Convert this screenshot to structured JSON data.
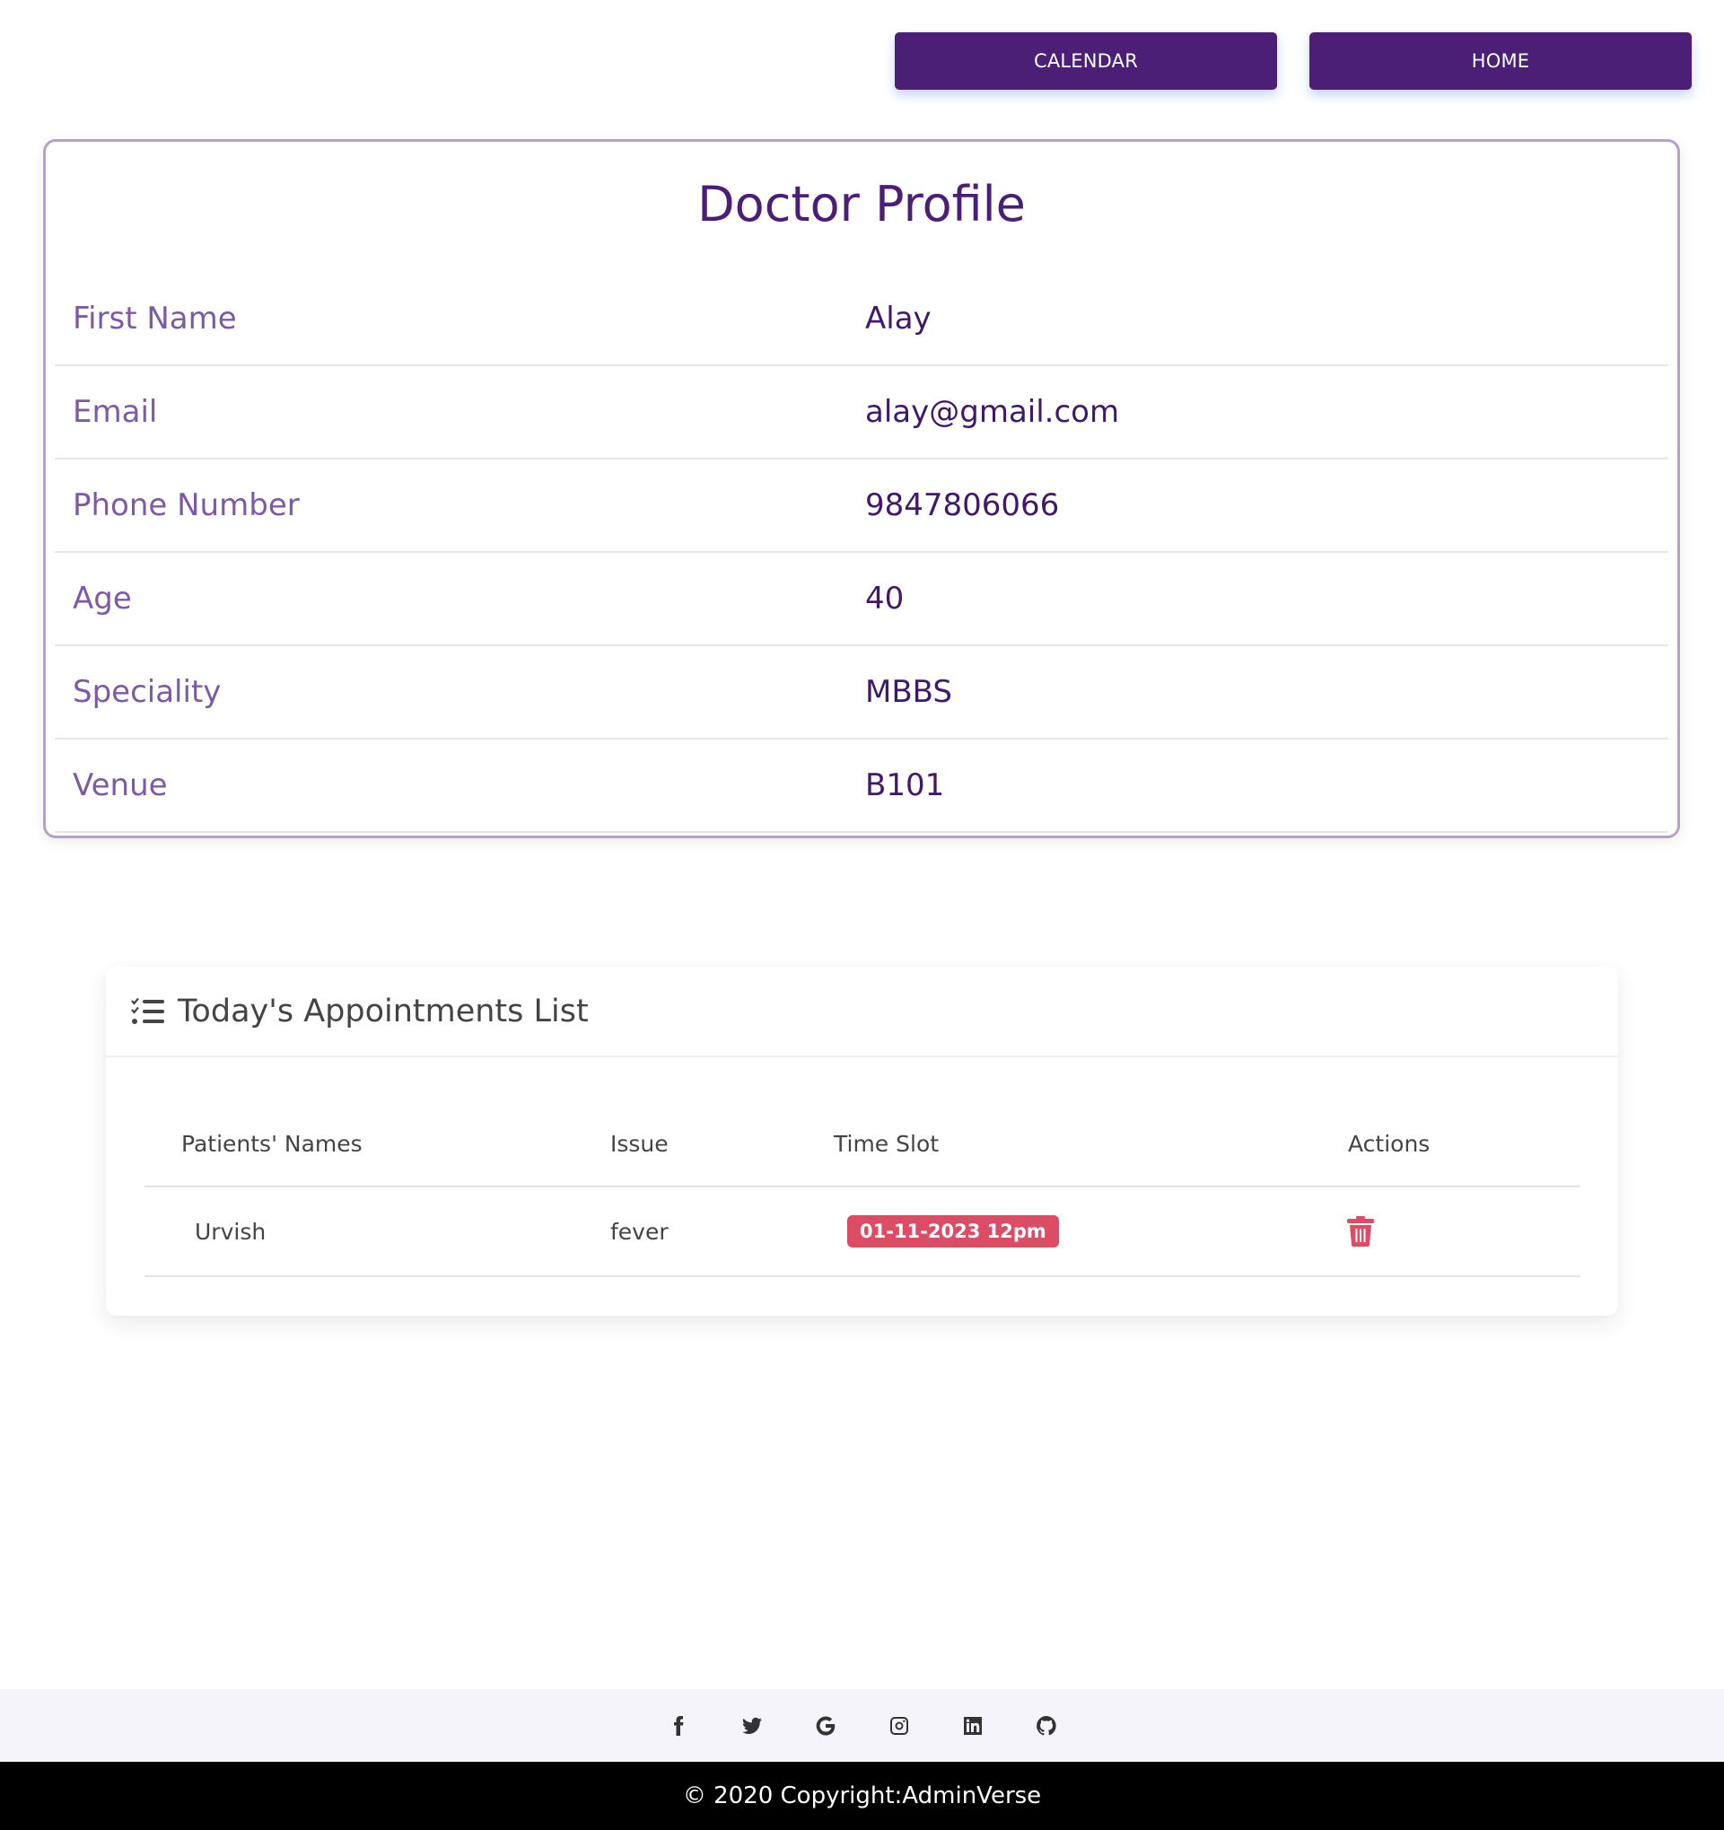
{
  "nav": {
    "calendar_label": "CALENDAR",
    "home_label": "HOME"
  },
  "profile": {
    "title": "Doctor Profile",
    "fields": [
      {
        "label": "First Name",
        "value": "Alay"
      },
      {
        "label": "Email",
        "value": "alay@gmail.com"
      },
      {
        "label": "Phone Number",
        "value": "9847806066"
      },
      {
        "label": "Age",
        "value": "40"
      },
      {
        "label": "Speciality",
        "value": "MBBS"
      },
      {
        "label": "Venue",
        "value": "B101"
      }
    ]
  },
  "appointments": {
    "title": "Today's Appointments List",
    "icon": "list-check-icon",
    "columns": [
      "Patients' Names",
      "Issue",
      "Time Slot",
      "Actions"
    ],
    "rows": [
      {
        "patient": "Urvish",
        "issue": "fever",
        "time_slot": "01-11-2023 12pm",
        "action_icon": "trash-icon"
      }
    ]
  },
  "footer": {
    "social_icons": [
      "facebook-icon",
      "twitter-icon",
      "google-icon",
      "instagram-icon",
      "linkedin-icon",
      "github-icon"
    ],
    "copyright": "© 2020 Copyright:AdminVerse"
  },
  "colors": {
    "brand": "#4a1f75",
    "label": "#7b5aa6",
    "badge": "#dc4c64",
    "card_border": "#b5a1cd"
  }
}
